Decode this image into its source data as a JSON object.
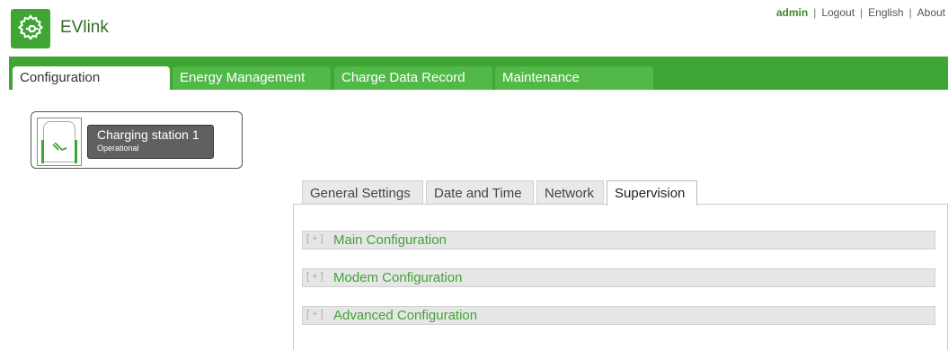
{
  "header": {
    "app_title": "EVlink",
    "logo_icon": "gear-plug-icon",
    "accent_color": "#3fa535",
    "user": "admin",
    "links": {
      "logout": "Logout",
      "language": "English",
      "about": "About"
    },
    "separator": "|"
  },
  "nav": {
    "tabs": [
      {
        "label": "Configuration",
        "active": true
      },
      {
        "label": "Energy Management",
        "active": false
      },
      {
        "label": "Charge Data Record",
        "active": false
      },
      {
        "label": "Maintenance",
        "active": false
      }
    ]
  },
  "station": {
    "name": "Charging station 1",
    "status": "Operational",
    "icon": "charging-station-icon"
  },
  "settings_tabs": [
    {
      "label": "General Settings",
      "active": false
    },
    {
      "label": "Date and Time",
      "active": false
    },
    {
      "label": "Network",
      "active": false
    },
    {
      "label": "Supervision",
      "active": true
    }
  ],
  "sections": [
    {
      "toggle": "[ + ]",
      "title": "Main Configuration"
    },
    {
      "toggle": "[ + ]",
      "title": "Modem Configuration"
    },
    {
      "toggle": "[ + ]",
      "title": "Advanced Configuration"
    }
  ]
}
